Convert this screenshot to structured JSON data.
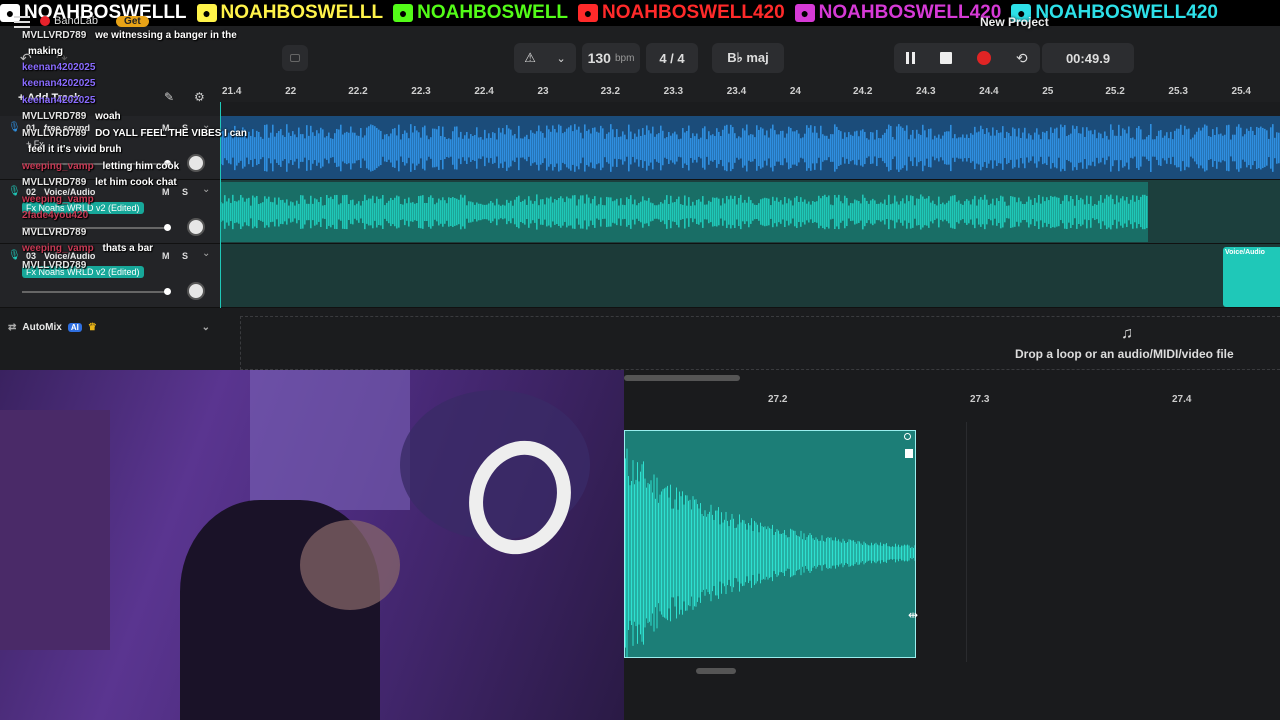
{
  "banner": {
    "items": [
      {
        "icon": "x-icon",
        "text": "NOAHBOSWELLL",
        "color": "#ffffff"
      },
      {
        "icon": "snapchat-icon",
        "text": "NOAHBOSWELLL",
        "color": "#fff34a"
      },
      {
        "icon": "kick-icon",
        "text": "NOAHBOSWELL",
        "color": "#53fc18"
      },
      {
        "icon": "youtube-icon",
        "text": "NOAHBOSWELL420",
        "color": "#ff2a2a"
      },
      {
        "icon": "instagram-icon",
        "text": "NOAHBOSWELL420",
        "color": "#d63ad6"
      },
      {
        "icon": "tiktok-icon",
        "text": "NOAHBOSWELL420",
        "color": "#2de0e8"
      }
    ]
  },
  "app": {
    "logo": "BandLab",
    "get_label": "Get",
    "project_title": "New Project"
  },
  "toolbar": {
    "tempo": "130",
    "tempo_unit": "bpm",
    "time_sig": "4 / 4",
    "key": "B♭ maj",
    "time": "00:49.9",
    "add_track": "+ Add Track"
  },
  "ruler": {
    "ticks": [
      "21.4",
      "22",
      "22.2",
      "22.3",
      "22.4",
      "23",
      "23.2",
      "23.3",
      "23.4",
      "24",
      "24.2",
      "24.3",
      "24.4",
      "25",
      "25.2",
      "25.3",
      "25.4"
    ]
  },
  "tracks": [
    {
      "number": "01",
      "name": "free sound",
      "fx": "+ Fx",
      "m": "M",
      "s": "S",
      "color": "#2f8fe0"
    },
    {
      "number": "02",
      "name": "Voice/Audio",
      "fx": "Fx Noahs WRLD v2 (Edited)",
      "m": "M",
      "s": "S",
      "color": "#1fc8b8"
    },
    {
      "number": "03",
      "name": "Voice/Audio",
      "fx": "Fx Noahs WRLD v2 (Edited)",
      "m": "M",
      "s": "S",
      "color": "#1fc8b8"
    }
  ],
  "clip_label": "Voice/Audio",
  "chat": [
    {
      "user": "MVLLVRD789",
      "msg": "we witnessing a banger in the",
      "cls": "user"
    },
    {
      "user": "",
      "msg": "making",
      "cls": "user"
    },
    {
      "user": "keenan4202025",
      "msg": "",
      "cls": "k"
    },
    {
      "user": "keenan4202025",
      "msg": "",
      "cls": "k"
    },
    {
      "user": "keenan4202025",
      "msg": "",
      "cls": "k"
    },
    {
      "user": "MVLLVRD789",
      "msg": "woah",
      "cls": "user"
    },
    {
      "user": "MVLLVRD789",
      "msg": "DO YALL FEEL THE VIBES I can",
      "cls": "user"
    },
    {
      "user": "",
      "msg": "feel it it's vivid bruh",
      "cls": "user"
    },
    {
      "user": "weeping_vamp",
      "msg": "letting him cook",
      "cls": "w"
    },
    {
      "user": "MVLLVRD789",
      "msg": "let him cook chat",
      "cls": "user"
    },
    {
      "user": "weeping_vamp",
      "msg": "",
      "cls": "w"
    },
    {
      "user": "2fade4you420",
      "msg": "",
      "cls": "w"
    },
    {
      "user": "MVLLVRD789",
      "msg": "",
      "cls": "user"
    },
    {
      "user": "weeping_vamp",
      "msg": "thats a bar",
      "cls": "w"
    },
    {
      "user": "MVLLVRD789",
      "msg": "",
      "cls": "user"
    }
  ],
  "automix": {
    "label": "AutoMix",
    "badge": "AI"
  },
  "dropzone": {
    "text": "Drop a loop or an audio/MIDI/video file"
  },
  "editor": {
    "ticks": [
      "27.2",
      "27.3",
      "27.4"
    ]
  },
  "colors": {
    "accent": "#1fc8b8",
    "blue": "#2f8fe0",
    "record": "#e02424"
  }
}
